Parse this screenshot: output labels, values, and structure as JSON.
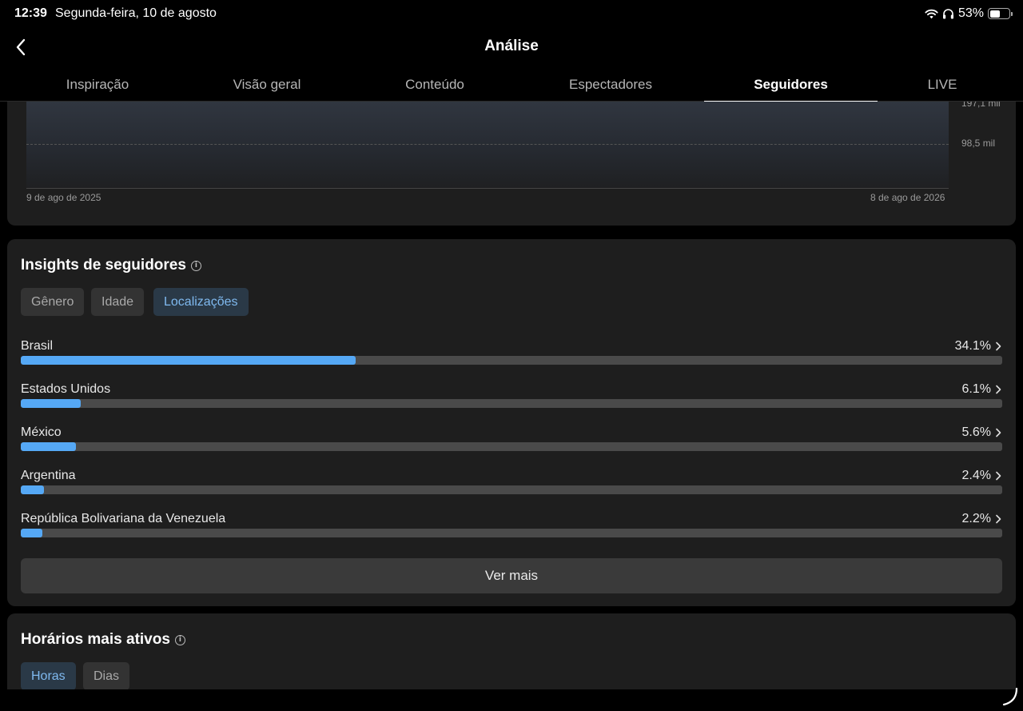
{
  "status": {
    "time": "12:39",
    "date": "Segunda-feira, 10 de agosto",
    "battery_percent": "53%",
    "battery_level": 0.53,
    "icons": [
      "wifi-icon",
      "headphones-icon",
      "battery-icon"
    ]
  },
  "header": {
    "title": "Análise",
    "back_icon": "chevron-left-icon"
  },
  "tabs": [
    {
      "label": "Inspiração",
      "active": false
    },
    {
      "label": "Visão geral",
      "active": false
    },
    {
      "label": "Conteúdo",
      "active": false
    },
    {
      "label": "Espectadores",
      "active": false
    },
    {
      "label": "Seguidores",
      "active": true
    },
    {
      "label": "LIVE",
      "active": false
    }
  ],
  "followers_chart": {
    "y_ticks": [
      "197,1 mil",
      "98,5 mil"
    ],
    "x_start": "9 de ago de 2025",
    "x_end": "8 de ago de 2026"
  },
  "insights": {
    "title": "Insights de seguidores",
    "chips": [
      {
        "label": "Gênero",
        "active": false
      },
      {
        "label": "Idade",
        "active": false
      },
      {
        "label": "Localizações",
        "active": true
      }
    ],
    "locations": [
      {
        "name": "Brasil",
        "percent": "34.1%",
        "value": 34.1
      },
      {
        "name": "Estados Unidos",
        "percent": "6.1%",
        "value": 6.1
      },
      {
        "name": "México",
        "percent": "5.6%",
        "value": 5.6
      },
      {
        "name": "Argentina",
        "percent": "2.4%",
        "value": 2.4
      },
      {
        "name": "República Bolivariana da Venezuela",
        "percent": "2.2%",
        "value": 2.2
      }
    ],
    "see_more_label": "Ver mais"
  },
  "active_hours": {
    "title": "Horários mais ativos",
    "chips": [
      {
        "label": "Horas",
        "active": true
      },
      {
        "label": "Dias",
        "active": false
      }
    ]
  },
  "colors": {
    "accent": "#55a8f5",
    "chip_active_text": "#7fb9ef",
    "card_bg": "#1e1e1e",
    "background": "#000000"
  }
}
